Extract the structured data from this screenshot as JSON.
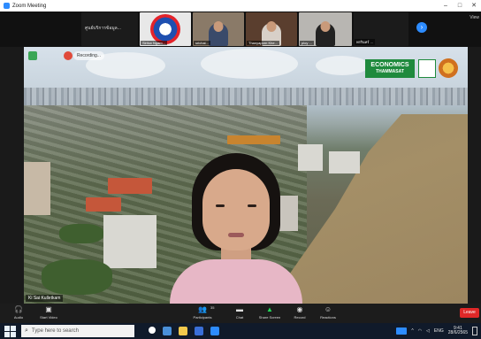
{
  "window": {
    "title": "Zoom Meeting",
    "controls": [
      "–",
      "□",
      "✕"
    ]
  },
  "thumbnails": [
    {
      "kind": "text",
      "text": "ศูนย์บริการข้อมูล...",
      "label": ""
    },
    {
      "kind": "logo",
      "label": "Sirilux Ngam..."
    },
    {
      "kind": "person",
      "label": "srichai..."
    },
    {
      "kind": "person",
      "label": "Thanyaporn Khe..."
    },
    {
      "kind": "person",
      "label": "ploy ..."
    },
    {
      "kind": "person",
      "label": "พรรินทร์ ..."
    }
  ],
  "strip": {
    "view_label": "View"
  },
  "stage": {
    "recording_label": "Recording...",
    "brand_title": "ECONOMICS",
    "brand_subtitle": "THAMMASAT",
    "presenter_name": "Ki Sai Kulletkam"
  },
  "toolbar": {
    "audio": "Audio",
    "video": "Start Video",
    "participants": "Participants",
    "participants_count": "35",
    "chat": "Chat",
    "share": "Share Screen",
    "record": "Record",
    "reactions": "Reactions",
    "leave": "Leave"
  },
  "taskbar": {
    "search_placeholder": "Type here to search",
    "time": "9:41",
    "date": "28/6/2565",
    "lang": "ENG"
  },
  "colors": {
    "accent": "#2d8cff",
    "leave": "#e02828",
    "brand": "#1f8a3d",
    "share": "#23d959"
  }
}
